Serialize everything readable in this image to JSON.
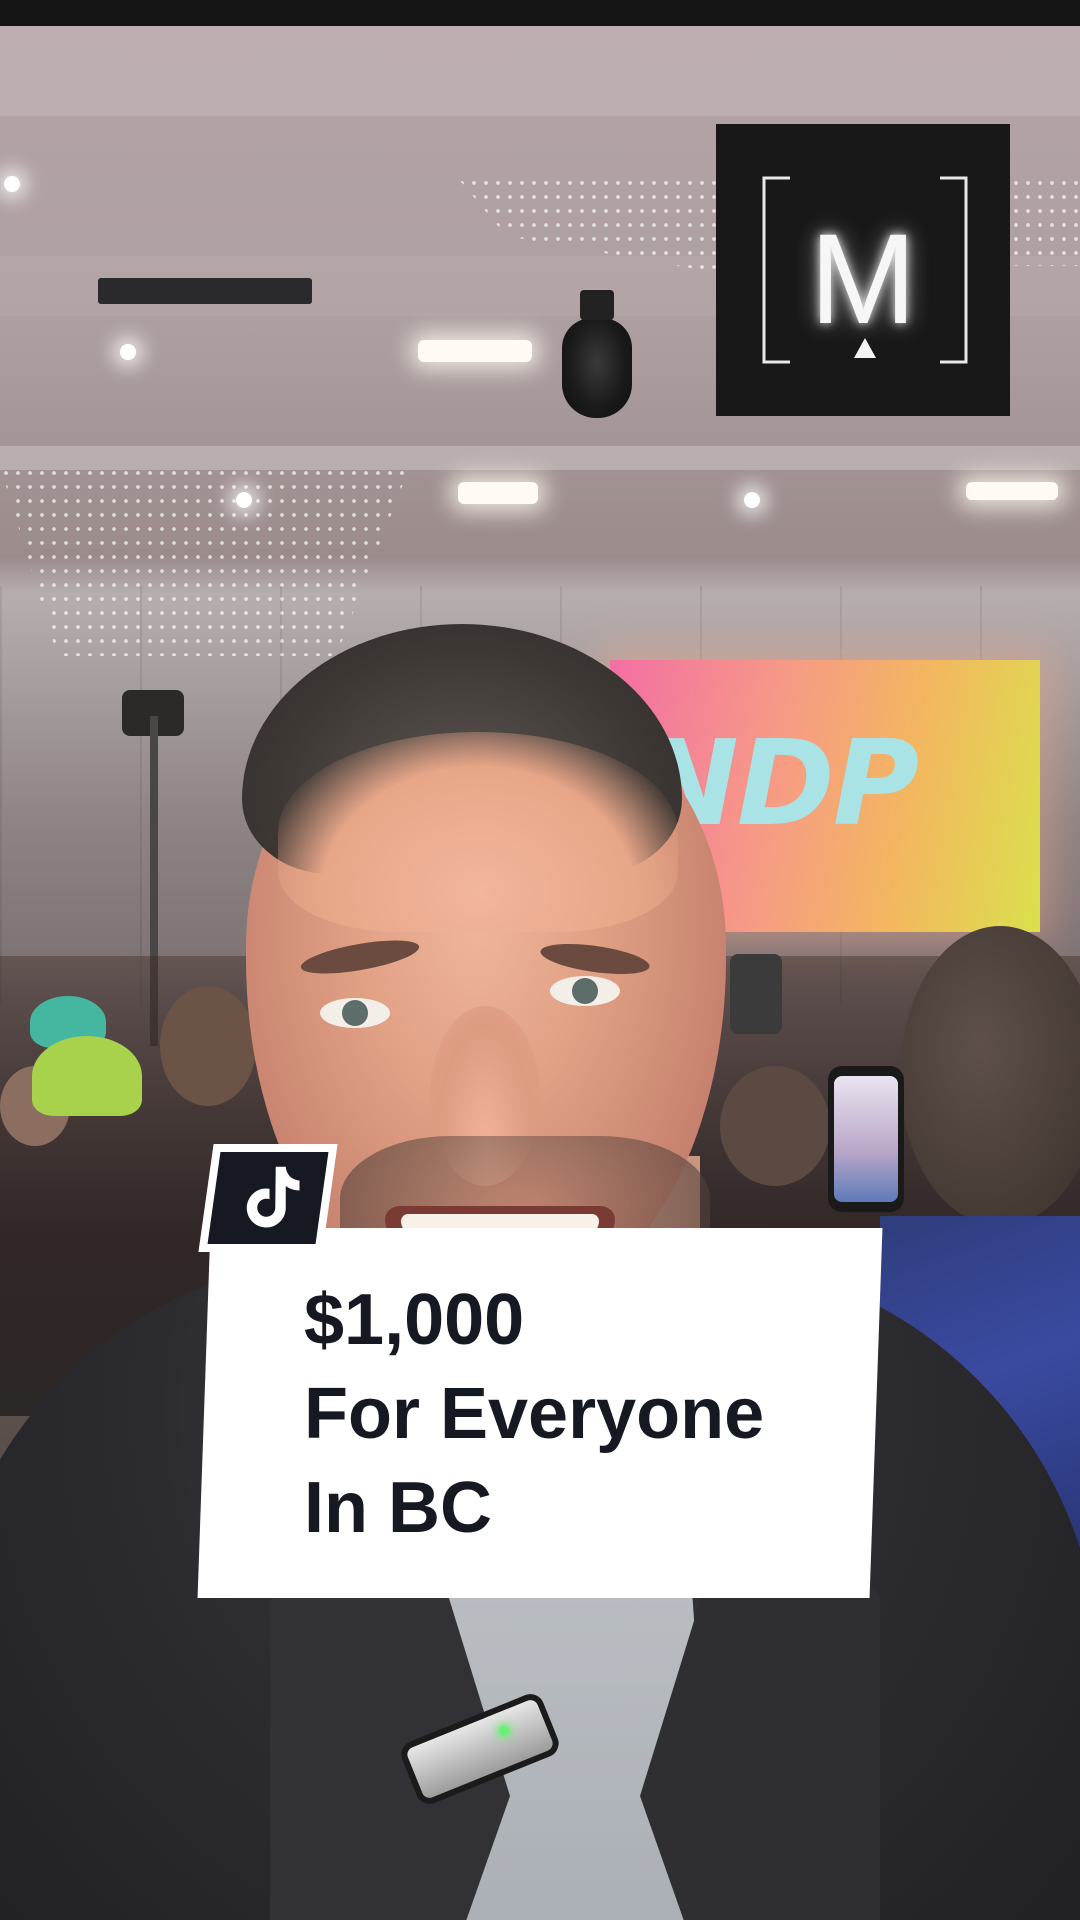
{
  "video": {
    "caption_lines": [
      "$1,000",
      "For Everyone",
      "In BC"
    ],
    "stage_screen_text": "NDP",
    "channel_logo_letter": "M"
  },
  "icons": {
    "platform": "tiktok-note-icon",
    "channel": "m-bracket-logo-icon"
  },
  "colors": {
    "caption_text": "#161822",
    "caption_background": "#ffffff",
    "stage_screen_text": "#a9e3e6",
    "logo_background": "#181818"
  }
}
